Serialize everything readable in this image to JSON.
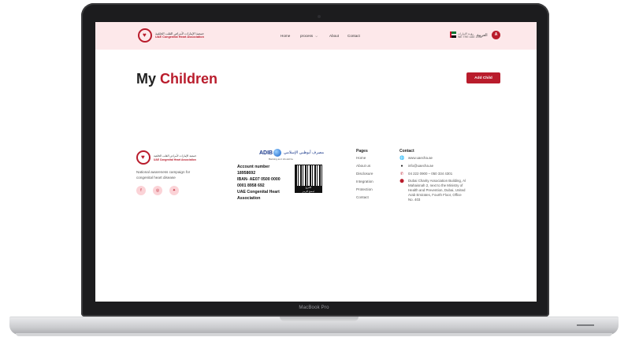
{
  "device": {
    "model_label": "MacBook Pro"
  },
  "navbar": {
    "logo_ar": "جمعية الإمارات لأمراض القلب الخلقية",
    "logo_en": "UAE Congenital Heart Association",
    "links": [
      "Home",
      "process",
      "About",
      "Contact"
    ],
    "vision_text": "رؤيـة الإمارات",
    "vision_sub": "WE THE UAE 2031",
    "language": "العربية",
    "avatar_initial": "A"
  },
  "page": {
    "title_part1": "My",
    "title_part2": "Children",
    "add_button": "Add Child"
  },
  "footer": {
    "logo_ar": "جمعية الإمارات لأمراض القلب الخلقية",
    "logo_en": "UAE Congenital Heart Association",
    "tagline": "National awareness campaign for congenital heart disease",
    "social": [
      "facebook-icon",
      "instagram-icon",
      "twitter-icon"
    ],
    "bank": {
      "name": "ADIB",
      "name_ar": "مصرف أبوظبي الإسلامي",
      "tagline": "Banking as it should be",
      "lines": [
        "Account number",
        "18958692",
        "IBAN- AE07 0500 0000",
        "0001 8958 692",
        "UAE Congenital Heart",
        "Association"
      ],
      "qr_caption": [
        "للتبرع",
        "امسح الرمز"
      ]
    },
    "pages": {
      "title": "Pages",
      "links": [
        "Home",
        "About us",
        "Disclosure",
        "Integration",
        "Protection",
        "Contact"
      ]
    },
    "contact": {
      "title": "Contact",
      "website": "www.uaecha.ae",
      "email": "info@uaecha.ae",
      "phone": "04 222 0900 – 050 334 4301",
      "address": "Dubai Charity Association Building, Al Mahaisnah 2, next to the Ministry of Health and Prevention, Dubai, United Arab Emirates, Fourth Floor, Office No. 403"
    }
  },
  "colors": {
    "accent": "#b91c2c",
    "nav_bg": "#fde8ea"
  }
}
